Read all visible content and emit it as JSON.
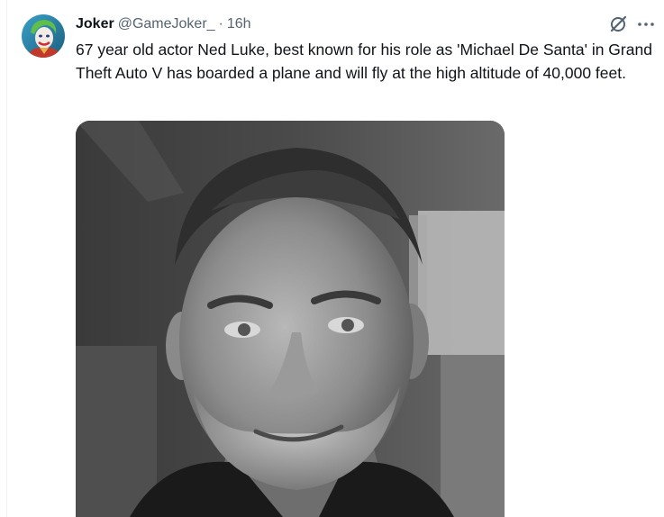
{
  "tweet": {
    "author_name": "Joker",
    "author_handle": "@GameJoker_",
    "separator": "·",
    "time": "16h",
    "text": "67 year old actor Ned Luke, best known for his role as 'Michael De Santa' in Grand Theft Auto V has boarded a plane and will fly at the high altitude of 40,000 feet."
  },
  "icons": {
    "grok": "grok-icon",
    "more": "more-dots-icon"
  },
  "colors": {
    "text": "#0f1419",
    "secondary_text": "#536471",
    "border": "#eff3f4"
  }
}
